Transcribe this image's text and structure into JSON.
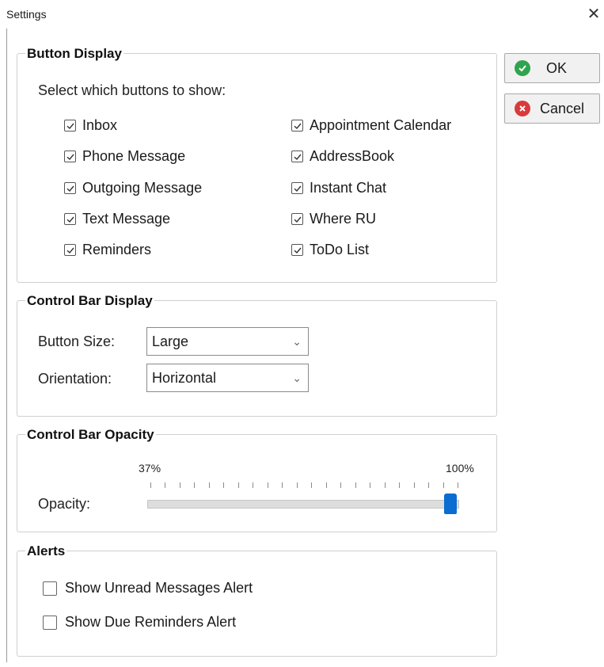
{
  "window": {
    "title": "Settings",
    "close": "✕"
  },
  "actions": {
    "ok_label": "OK",
    "cancel_label": "Cancel"
  },
  "button_display": {
    "title": "Button Display",
    "prompt": "Select which buttons to show:",
    "left_items": [
      {
        "label": "Inbox",
        "checked": true
      },
      {
        "label": "Phone Message",
        "checked": true
      },
      {
        "label": "Outgoing Message",
        "checked": true
      },
      {
        "label": "Text Message",
        "checked": true
      },
      {
        "label": "Reminders",
        "checked": true
      }
    ],
    "right_items": [
      {
        "label": "Appointment Calendar",
        "checked": true
      },
      {
        "label": "AddressBook",
        "checked": true
      },
      {
        "label": "Instant Chat",
        "checked": true
      },
      {
        "label": "Where RU",
        "checked": true
      },
      {
        "label": "ToDo List",
        "checked": true
      }
    ]
  },
  "control_bar_display": {
    "title": "Control Bar Display",
    "button_size_label": "Button Size:",
    "button_size_value": "Large",
    "orientation_label": "Orientation:",
    "orientation_value": "Horizontal"
  },
  "control_bar_opacity": {
    "title": "Control Bar Opacity",
    "min_label": "37%",
    "max_label": "100%",
    "opacity_label": "Opacity:",
    "value_percent": 100
  },
  "alerts": {
    "title": "Alerts",
    "items": [
      {
        "label": "Show Unread Messages Alert",
        "checked": false
      },
      {
        "label": "Show Due Reminders Alert",
        "checked": false
      }
    ]
  },
  "colors": {
    "ok": "#2ea44f",
    "cancel": "#d93a3a",
    "slider": "#0b6cd1"
  }
}
